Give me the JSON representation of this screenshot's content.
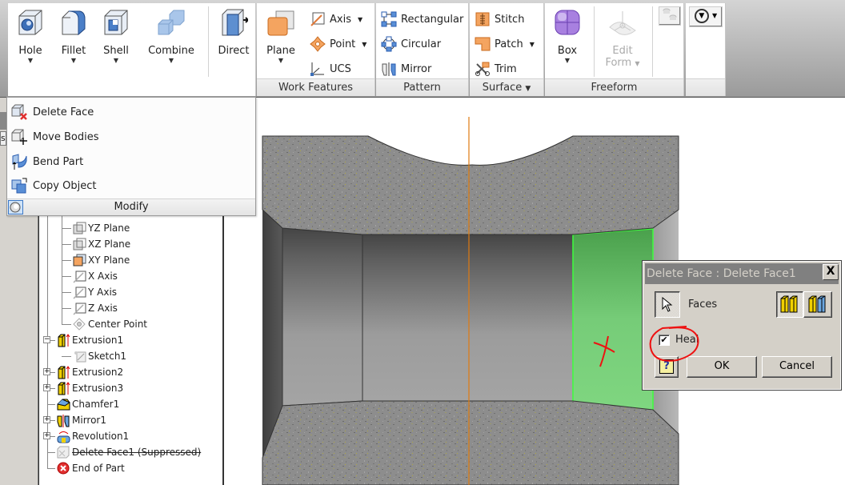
{
  "ribbon": {
    "modify_panel": {
      "buttons": [
        {
          "label": "Hole",
          "icon": "hole-icon"
        },
        {
          "label": "Fillet",
          "icon": "fillet-icon"
        },
        {
          "label": "Shell",
          "icon": "shell-icon"
        },
        {
          "label": "Combine",
          "icon": "combine-icon"
        },
        {
          "label": "Direct",
          "icon": "direct-edit-icon"
        }
      ]
    },
    "work_features": {
      "label": "Work Features",
      "plane_label": "Plane",
      "axis_label": "Axis",
      "point_label": "Point",
      "ucs_label": "UCS"
    },
    "pattern": {
      "label": "Pattern",
      "rectangular_label": "Rectangular",
      "circular_label": "Circular",
      "mirror_label": "Mirror"
    },
    "surface": {
      "label": "Surface",
      "stitch_label": "Stitch",
      "patch_label": "Patch",
      "trim_label": "Trim"
    },
    "freeform": {
      "label": "Freeform",
      "box_label": "Box",
      "edit_form_label_1": "Edit",
      "edit_form_label_2": "Form"
    }
  },
  "modify_menu": {
    "title": "Modify",
    "items": [
      {
        "label": "Delete Face",
        "icon": "delete-face-icon"
      },
      {
        "label": "Move Bodies",
        "icon": "move-bodies-icon"
      },
      {
        "label": "Bend Part",
        "icon": "bend-part-icon"
      },
      {
        "label": "Copy Object",
        "icon": "copy-object-icon"
      }
    ]
  },
  "browser": {
    "work_items": [
      {
        "label": "YZ Plane",
        "icon": "plane-icon"
      },
      {
        "label": "XZ Plane",
        "icon": "plane-icon"
      },
      {
        "label": "XY Plane",
        "icon": "plane-active-icon"
      },
      {
        "label": "X Axis",
        "icon": "axis-icon"
      },
      {
        "label": "Y Axis",
        "icon": "axis-icon"
      },
      {
        "label": "Z Axis",
        "icon": "axis-icon"
      },
      {
        "label": "Center Point",
        "icon": "center-point-icon"
      }
    ],
    "features": [
      {
        "label": "Extrusion1",
        "icon": "extrusion-icon",
        "expander": "−"
      },
      {
        "label": "Sketch1",
        "icon": "sketch-icon",
        "child": true
      },
      {
        "label": "Extrusion2",
        "icon": "extrusion-icon",
        "expander": "+"
      },
      {
        "label": "Extrusion3",
        "icon": "extrusion-icon",
        "expander": "+"
      },
      {
        "label": "Chamfer1",
        "icon": "chamfer-icon"
      },
      {
        "label": "Mirror1",
        "icon": "mirror-icon",
        "expander": "+"
      },
      {
        "label": "Revolution1",
        "icon": "revolution-icon",
        "expander": "+"
      },
      {
        "label": "Delete Face1 (Suppressed)",
        "icon": "delete-face-icon",
        "suppressed": true
      },
      {
        "label": "End of Part",
        "icon": "end-of-part-icon"
      }
    ]
  },
  "dialog": {
    "title": "Delete Face : Delete Face1",
    "close_label": "X",
    "faces_label": "Faces",
    "heal_label": "Heal",
    "heal_checked": true,
    "ok_label": "OK",
    "cancel_label": "Cancel",
    "help_label": "?"
  },
  "annotations": {
    "x_mark": "X"
  },
  "colors": {
    "selected_face": "#7dd47f",
    "selection_edge": "#3cff3c",
    "centerline": "#e07a10",
    "annotation": "#ee1111"
  }
}
